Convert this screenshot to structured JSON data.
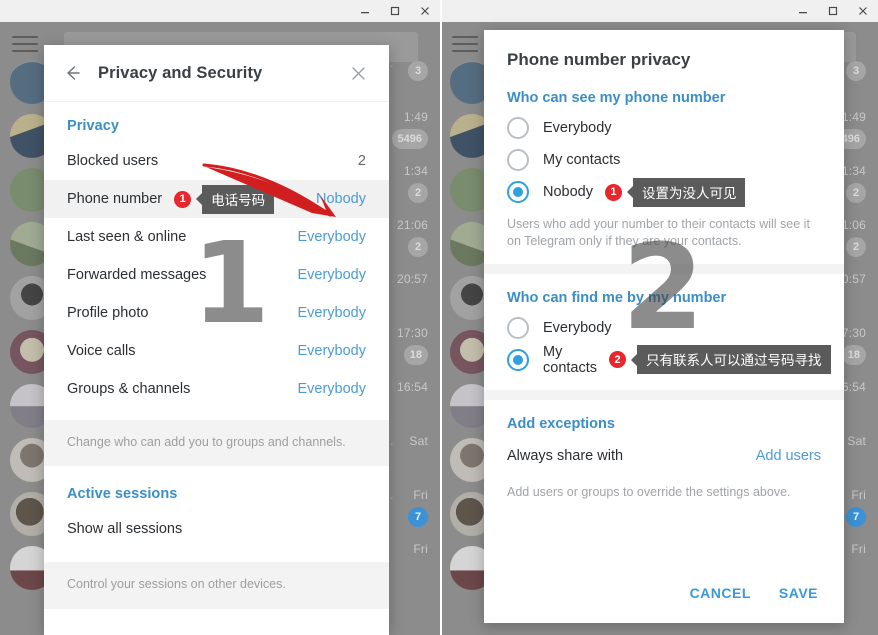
{
  "colors": {
    "accent_blue": "#3a8fc4",
    "link_blue": "#4a9cd6",
    "radio_blue": "#2f9fe0",
    "badge_red": "#e8262b",
    "arrow_red": "#d11f1f",
    "tooltip_bg": "#5b5b5b",
    "dim_background": "#8c8c8c"
  },
  "window_controls": {
    "minimize": "minimize",
    "maximize": "maximize",
    "close": "close"
  },
  "left_window": {
    "dialog": {
      "title": "Privacy and Security",
      "back_label": "Back",
      "close_label": "Close",
      "sections": [
        {
          "title": "Privacy",
          "rows": [
            {
              "label": "Blocked users",
              "value": "2",
              "value_style": "plain",
              "highlight": false
            },
            {
              "label": "Phone number",
              "value": "Nobody",
              "value_style": "link",
              "highlight": true,
              "badge": "1",
              "tooltip": "电话号码"
            },
            {
              "label": "Last seen & online",
              "value": "Everybody",
              "value_style": "link",
              "highlight": false
            },
            {
              "label": "Forwarded messages",
              "value": "Everybody",
              "value_style": "link",
              "highlight": false
            },
            {
              "label": "Profile photo",
              "value": "Everybody",
              "value_style": "link",
              "highlight": false
            },
            {
              "label": "Voice calls",
              "value": "Everybody",
              "value_style": "link",
              "highlight": false
            },
            {
              "label": "Groups & channels",
              "value": "Everybody",
              "value_style": "link",
              "highlight": false
            }
          ],
          "hint": "Change who can add you to groups and channels."
        },
        {
          "title": "Active sessions",
          "rows": [
            {
              "label": "Show all sessions",
              "value": "",
              "value_style": "plain",
              "highlight": false
            }
          ],
          "hint": "Control your sessions on other devices."
        }
      ]
    },
    "annotation_number": "1"
  },
  "right_window": {
    "dialog": {
      "title": "Phone number privacy",
      "groups": [
        {
          "title": "Who can see my phone number",
          "options": [
            {
              "label": "Everybody",
              "selected": false
            },
            {
              "label": "My contacts",
              "selected": false
            },
            {
              "label": "Nobody",
              "selected": true,
              "badge": "1",
              "tooltip": "设置为没人可见"
            }
          ],
          "note": "Users who add your number to their contacts will see it on Telegram only if they are your contacts."
        },
        {
          "title": "Who can find me by my number",
          "options": [
            {
              "label": "Everybody",
              "selected": false
            },
            {
              "label": "My contacts",
              "selected": true,
              "badge": "2",
              "tooltip": "只有联系人可以通过号码寻找"
            }
          ],
          "note": ""
        }
      ],
      "exceptions": {
        "title": "Add exceptions",
        "row_label": "Always share with",
        "row_action": "Add users",
        "hint": "Add users or groups to override the settings above."
      },
      "buttons": {
        "cancel": "CANCEL",
        "save": "SAVE"
      }
    },
    "annotation_number": "2"
  },
  "background_chatlist": {
    "rows": [
      {
        "time": "",
        "badge": "3",
        "badge_style": "gray",
        "preview": "e…"
      },
      {
        "time": "1:49",
        "badge": "5496",
        "badge_style": "gray",
        "preview": ""
      },
      {
        "time": "1:34",
        "badge": "2",
        "badge_style": "gray",
        "preview": ""
      },
      {
        "time": "21:06",
        "badge": "2",
        "badge_style": "gray",
        "preview": ""
      },
      {
        "time": "20:57",
        "badge": "",
        "badge_style": "gray",
        "preview": ""
      },
      {
        "time": "17:30",
        "badge": "18",
        "badge_style": "gray",
        "preview": ""
      },
      {
        "time": "16:54",
        "badge": "",
        "badge_style": "gray",
        "preview": ""
      },
      {
        "time": "Sat",
        "badge": "",
        "badge_style": "gray",
        "preview": "KM_…"
      },
      {
        "time": "Fri",
        "badge": "7",
        "badge_style": "blue",
        "preview": "s…"
      },
      {
        "time": "Fri",
        "badge": "",
        "badge_style": "gray",
        "preview": ""
      }
    ]
  }
}
